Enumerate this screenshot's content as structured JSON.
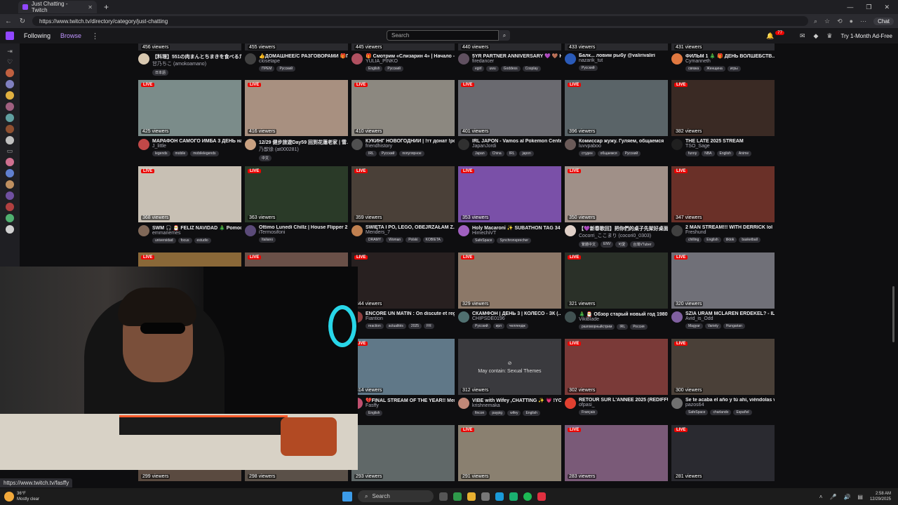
{
  "browser": {
    "tab_title": "Just Chatting - Twitch",
    "tab_close": "✕",
    "new_tab": "+",
    "url": "https://www.twitch.tv/directory/category/just-chatting",
    "chat_label": "Chat",
    "window_controls": [
      "—",
      "❐",
      "✕"
    ]
  },
  "twitch_nav": {
    "following": "Following",
    "browse": "Browse",
    "more": "⋮",
    "search_placeholder": "Search",
    "notifications_count": "77",
    "turbo_label": "Try 1-Month Ad-Free"
  },
  "rows": [
    {
      "cards": [
        {
          "viewers": "456 viewers",
          "title": "【料理】551の肉まんとちまきを食べるた...",
          "channel": "甘乃ちこ (amokoamano)",
          "tags": [
            "日本語"
          ],
          "avatar": "#d8c8b0"
        },
        {
          "viewers": "455 viewers",
          "title": "👍ДОМАШНЕЕ/С РАЗГОВОРАМИ 🎁П...",
          "channel": "closetape",
          "tags": [
            "ПРЕМ",
            "Русский"
          ],
          "avatar": "#404040"
        },
        {
          "viewers": "445 viewers",
          "title": "🎁 Смотрим «Слизарин 4» | Начало - ...",
          "channel": "YULIA_PINKO",
          "tags": [
            "English",
            "Русский"
          ],
          "avatar": "#b05060"
        },
        {
          "viewers": "440 viewers",
          "title": "5YR PARTNER ANNIVERSARY 💜 🤎 HO...",
          "channel": "firedancer",
          "tags": [
            "egirl",
            "uwu",
            "Goddess",
            "Cosplay"
          ],
          "avatar": "#605060"
        },
        {
          "viewers": "433 viewers",
          "title": "Балк... ловим рыбу @valirivaliri",
          "channel": "nazarik_tut",
          "tags": [
            "Русский"
          ],
          "avatar": "#2a5ab8"
        },
        {
          "viewers": "431 viewers",
          "title": "ФИЛЬМ 1 🎄 🎁 ДЕНЬ ВОЛШЕБСТВ...",
          "channel": "Cymanneth",
          "tags": [
            "связка",
            "Женщина",
            "игры"
          ],
          "avatar": "#e07840"
        }
      ]
    },
    {
      "cards": [
        {
          "live": "LIVE",
          "viewers": "425 viewers",
          "title": "МАРАФОН САМОГО ИМБА 3 ДЕНЬ на...",
          "channel": "J_little",
          "tags": [
            "legends",
            "mobile",
            "mobilelegends"
          ],
          "thumb": "#7b8c8a",
          "avatar": "#c04848"
        },
        {
          "live": "LIVE",
          "viewers": "416 viewers",
          "title": "12/29 健步旅遊Day59 回到花蓮老家 | 雪...",
          "channel": "乃歆徐 (at000281)",
          "tags": [
            "中文"
          ],
          "thumb": "#a89080",
          "avatar": "#c8a080"
        },
        {
          "live": "LIVE",
          "viewers": "410 viewers",
          "title": "КУКИНГ НОВОГОДНИЙ | !тт донат !ро...",
          "channel": "friendhistory",
          "tags": [
            "IRL",
            "Русский",
            "популярное"
          ],
          "thumb": "#8c8880",
          "avatar": "#505050"
        },
        {
          "live": "LIVE",
          "viewers": "401 viewers",
          "title": "IRL JAPÓN - Vamos al Pokemon Center...",
          "channel": "JapanJordi",
          "tags": [
            "Japan",
            "China",
            "IRL",
            "japon"
          ],
          "thumb": "#6a6a70",
          "avatar": "#303030"
        },
        {
          "live": "LIVE",
          "viewers": "396 viewers",
          "title": "Комиссар жужу. Гуляем, общаемся",
          "channel": "luvvpaboo",
          "tags": [
            "студен",
            "общаемся",
            "Русский"
          ],
          "thumb": "#5a6468",
          "avatar": "#6a5a58"
        },
        {
          "live": "LIVE",
          "viewers": "382 viewers",
          "title": "THE LATE 2025 STREAM",
          "channel": "TSO_Sage",
          "tags": [
            "funny",
            "NBA",
            "English",
            "Anime"
          ],
          "thumb": "#3a2a24",
          "avatar": "#202020"
        }
      ]
    },
    {
      "cards": [
        {
          "live": "LIVE",
          "viewers": "368 viewers",
          "title": "SWM 🎧 🎅 FELIZ NAVIDAD 🎄 Pomodor...",
          "channel": "emmanemes",
          "tags": [
            "universidad",
            "focus",
            "estudio"
          ],
          "thumb": "#c8c0b4",
          "avatar": "#806858"
        },
        {
          "live": "LIVE",
          "viewers": "363 viewers",
          "title": "Ottimo Lunedì Chillz | House Flipper 2 [...",
          "channel": "iTermosifoni",
          "tags": [
            "Italiano"
          ],
          "thumb": "#2a3a28",
          "avatar": "#5a4a78"
        },
        {
          "live": "LIVE",
          "viewers": "359 viewers",
          "title": "ŚWIĘTA I PO, LEGO, OBEJRZAŁAM Z...",
          "channel": "Menders_7",
          "tags": [
            "DRAMY",
            "Woman",
            "Polski",
            "KOBIETA"
          ],
          "thumb": "#4a4038",
          "avatar": "#c08050"
        },
        {
          "live": "LIVE",
          "viewers": "353 viewers",
          "title": "Holy Macaroni ✨ SUBATHON TAG 34 |...",
          "channel": "HimechiVT",
          "tags": [
            "SafeSpace",
            "Synchronsprecher"
          ],
          "thumb": "#7a50a8",
          "avatar": "#a060c0"
        },
        {
          "live": "LIVE",
          "viewers": "350 viewers",
          "title": "【💜新春歌回】把你們的桌子先架好桌面...",
          "channel": "Cocorri_ここまり (cocori0_0303)",
          "tags": [
            "繁體中文",
            "ENV",
            "可愛",
            "台灣VTuber"
          ],
          "thumb": "#a09088",
          "avatar": "#e0d0c8"
        },
        {
          "live": "LIVE",
          "viewers": "347 viewers",
          "title": "2 MAN STREAM!!! WITH DERRICK lol",
          "channel": "Freshund",
          "tags": [
            "chilling",
            "English",
            "tiktok",
            "basketball"
          ],
          "thumb": "#6a3028",
          "avatar": "#404040"
        }
      ]
    },
    {
      "cards": [
        {
          "live": "LIVE",
          "viewers": "",
          "title": "",
          "channel": "",
          "tags": [],
          "thumb": "#8a6838",
          "avatar": "#606060"
        },
        {
          "live": "LIVE",
          "viewers": "",
          "title": "",
          "channel": "",
          "tags": [],
          "thumb": "#6a5048",
          "avatar": "#606060"
        },
        {
          "live": "LIVE",
          "viewers": "344 viewers",
          "title": "ENCORE UN MATIN : On discute et rega...",
          "channel": "Fiantion",
          "tags": [
            "reaction",
            "actualités",
            "2025",
            "FR"
          ],
          "thumb": "#282020",
          "avatar": "#904040"
        },
        {
          "live": "LIVE",
          "viewers": "329 viewers",
          "title": "СКАМФОН | ДЕНЬ 3 | КОЛЕСО - ЗК (...",
          "channel": "CHIPSDE0196",
          "tags": [
            "Русский",
            "ирл",
            "челлендж"
          ],
          "thumb": "#8c7868",
          "avatar": "#507070"
        },
        {
          "live": "LIVE",
          "viewers": "321 viewers",
          "title": "🎄 🎅 Обзор старый новый год 1980 !!...",
          "channel": "VikiBlade",
          "tags": [
            "разговорныйстрим",
            "IRL",
            "Россия"
          ],
          "thumb": "#2a3028",
          "avatar": "#405050"
        },
        {
          "live": "LIVE",
          "viewers": "320 viewers",
          "title": "SZIA URAM MCLAREN ÉRDEKEL? - ILE...",
          "channel": "Avid_is_Odd",
          "tags": [
            "Magyar",
            "Variety",
            "Hungarian"
          ],
          "thumb": "#707078",
          "avatar": "#8060a0"
        }
      ]
    },
    {
      "cards": [
        {
          "live": "",
          "viewers": "",
          "title": "",
          "channel": "",
          "tags": [],
          "thumb": "#3a3a3a",
          "avatar": "#606060"
        },
        {
          "live": "",
          "viewers": "",
          "title": "",
          "channel": "",
          "tags": [],
          "thumb": "#3a3a3a",
          "avatar": "#606060"
        },
        {
          "live": "LIVE",
          "viewers": "314 viewers",
          "title": "💔FINAL STREAM OF THE YEAR!! Mem...",
          "channel": "Fasffy",
          "tags": [
            "English"
          ],
          "thumb": "#607888",
          "avatar": "#c05070"
        },
        {
          "live": "",
          "viewers": "312 viewers",
          "title": "VIBE with Wifey ,CHATTING ✨ 💗 !YO...",
          "channel": "krishnemaka",
          "tags": [
            "fincon",
            "paypig",
            "wifey",
            "English"
          ],
          "sensitive": "May contain: Sexual Themes",
          "avatar": "#c08878"
        },
        {
          "live": "LIVE",
          "viewers": "302 viewers",
          "title": "RETOUR SUR L'ANNÉE 2025 (REDIFFUS...",
          "channel": "ofpasi_",
          "tags": [
            "Français"
          ],
          "thumb": "#7a3a38",
          "avatar": "#e04030"
        },
        {
          "live": "LIVE",
          "viewers": "300 viewers",
          "title": "Se te acaba el año y tú ahí, viéndolas v...",
          "channel": "pazos64",
          "tags": [
            "SafeSpace",
            "charlando",
            "Español"
          ],
          "thumb": "#4a4038",
          "avatar": "#707070"
        }
      ]
    },
    {
      "cards": [
        {
          "live": "",
          "viewers": "299 viewers",
          "title": "",
          "channel": "",
          "tags": [],
          "thumb": "#5a4a40",
          "avatar": "#606060"
        },
        {
          "live": "",
          "viewers": "298 viewers",
          "title": "",
          "channel": "",
          "tags": [],
          "thumb": "#5a5048",
          "avatar": "#606060"
        },
        {
          "live": "",
          "viewers": "293 viewers",
          "title": "",
          "channel": "",
          "tags": [],
          "thumb": "#606868",
          "avatar": "#606060"
        },
        {
          "live": "LIVE",
          "viewers": "291 viewers",
          "title": "",
          "channel": "",
          "tags": [],
          "thumb": "#8a8070",
          "avatar": "#606060"
        },
        {
          "live": "LIVE",
          "viewers": "283 viewers",
          "title": "",
          "channel": "",
          "tags": [],
          "thumb": "#7a5a78",
          "avatar": "#606060"
        },
        {
          "live": "LIVE",
          "viewers": "281 viewers",
          "title": "",
          "channel": "",
          "tags": [],
          "thumb": "#2a2a30",
          "avatar": "#606060"
        }
      ]
    }
  ],
  "status_url": "https://www.twitch.tv/fasffy",
  "taskbar": {
    "temperature": "36°F",
    "weather": "Mostly clear",
    "search_label": "Search",
    "time": "2:58 AM",
    "date": "12/29/2025"
  },
  "colors": {
    "accent": "#9147ff",
    "live": "#eb0400",
    "background": "#0e0e10"
  }
}
